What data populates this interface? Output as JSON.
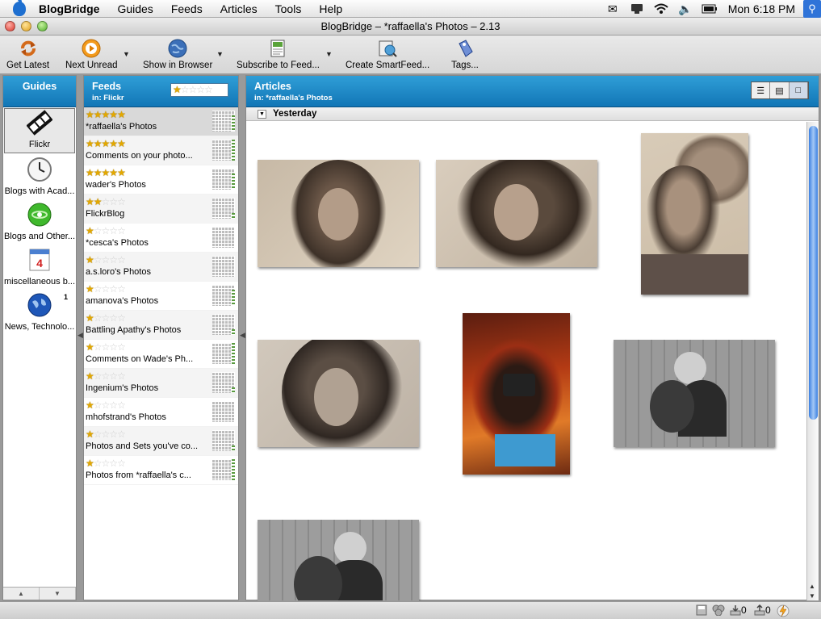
{
  "menubar": {
    "app_name": "BlogBridge",
    "menus": [
      "Guides",
      "Feeds",
      "Articles",
      "Tools",
      "Help"
    ],
    "clock": "Mon 6:18 PM",
    "status_icons": [
      "mail-icon",
      "chat-icon",
      "wifi-icon",
      "volume-icon",
      "battery-icon",
      "spotlight-icon"
    ]
  },
  "window": {
    "title": "BlogBridge – *raffaella's Photos – 2.13"
  },
  "toolbar": {
    "get_latest": "Get Latest",
    "next_unread": "Next Unread",
    "show_in_browser": "Show in Browser",
    "subscribe": "Subscribe to Feed...",
    "create_smartfeed": "Create SmartFeed...",
    "tags": "Tags..."
  },
  "guides": {
    "title": "Guides",
    "items": [
      {
        "label": "Flickr",
        "icon": "film-icon",
        "badge": ""
      },
      {
        "label": "Blogs with Acad...",
        "icon": "clock-icon",
        "badge": ""
      },
      {
        "label": "Blogs and Other...",
        "icon": "green-globe-icon",
        "badge": ""
      },
      {
        "label": "miscellaneous b...",
        "icon": "calendar-icon",
        "badge": ""
      },
      {
        "label": "News, Technolo...",
        "icon": "earth-icon",
        "badge": "1"
      }
    ]
  },
  "feeds": {
    "title": "Feeds",
    "subtitle": "in: Flickr",
    "filter_rating": 1,
    "items": [
      {
        "name": "*raffaella's Photos",
        "rating": 5,
        "activity": 3
      },
      {
        "name": "Comments on your photo...",
        "rating": 5,
        "activity": 4
      },
      {
        "name": "wader's Photos",
        "rating": 5,
        "activity": 3
      },
      {
        "name": "FlickrBlog",
        "rating": 2,
        "activity": 1
      },
      {
        "name": "*cesca's Photos",
        "rating": 1,
        "activity": 0
      },
      {
        "name": "a.s.loro's Photos",
        "rating": 1,
        "activity": 0
      },
      {
        "name": "amanova's Photos",
        "rating": 1,
        "activity": 3
      },
      {
        "name": "Battling Apathy's Photos",
        "rating": 1,
        "activity": 1
      },
      {
        "name": "Comments on Wade's Ph...",
        "rating": 1,
        "activity": 4
      },
      {
        "name": "Ingenium's Photos",
        "rating": 1,
        "activity": 1
      },
      {
        "name": "mhofstrand's Photos",
        "rating": 1,
        "activity": 0
      },
      {
        "name": "Photos and Sets you've co...",
        "rating": 1,
        "activity": 1
      },
      {
        "name": "Photos from *raffaella's c...",
        "rating": 1,
        "activity": 4
      }
    ]
  },
  "articles": {
    "title": "Articles",
    "subtitle": "in: *raffaella's Photos",
    "group": "Yesterday"
  },
  "status": {
    "download_count": "0",
    "upload_count": "0"
  }
}
